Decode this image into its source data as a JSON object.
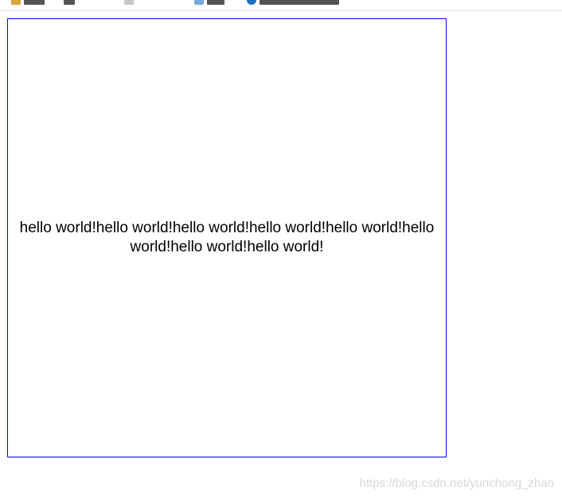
{
  "content": {
    "text": "hello world!hello world!hello world!hello world!hello world!hello world!hello world!hello world!"
  },
  "watermark": {
    "text": "https://blog.csdn.net/yunchong_zhao"
  },
  "colors": {
    "box_border": "#0000ff",
    "text": "#000000",
    "watermark": "#d7d7d7"
  },
  "bookmarks_bar": {
    "icons": [
      "folder-icon",
      "page-icon",
      "doc-icon",
      "globe-icon"
    ]
  }
}
